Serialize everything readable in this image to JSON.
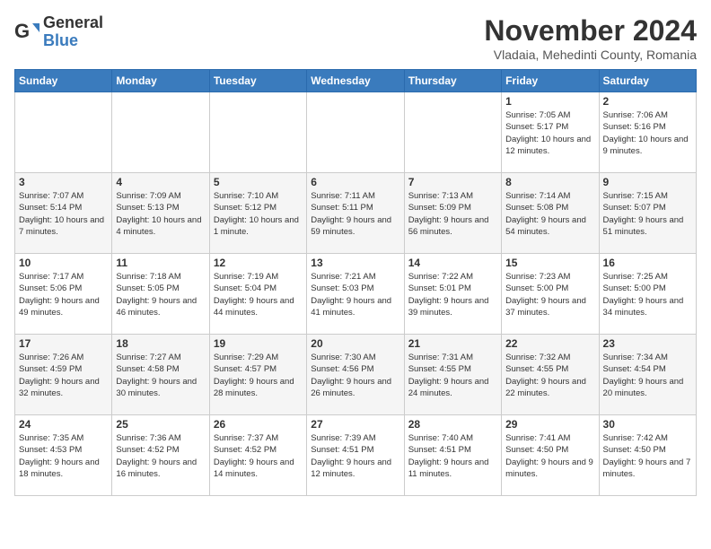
{
  "logo": {
    "general": "General",
    "blue": "Blue"
  },
  "header": {
    "month": "November 2024",
    "location": "Vladaia, Mehedinti County, Romania"
  },
  "weekdays": [
    "Sunday",
    "Monday",
    "Tuesday",
    "Wednesday",
    "Thursday",
    "Friday",
    "Saturday"
  ],
  "weeks": [
    [
      {
        "day": "",
        "info": ""
      },
      {
        "day": "",
        "info": ""
      },
      {
        "day": "",
        "info": ""
      },
      {
        "day": "",
        "info": ""
      },
      {
        "day": "",
        "info": ""
      },
      {
        "day": "1",
        "info": "Sunrise: 7:05 AM\nSunset: 5:17 PM\nDaylight: 10 hours and 12 minutes."
      },
      {
        "day": "2",
        "info": "Sunrise: 7:06 AM\nSunset: 5:16 PM\nDaylight: 10 hours and 9 minutes."
      }
    ],
    [
      {
        "day": "3",
        "info": "Sunrise: 7:07 AM\nSunset: 5:14 PM\nDaylight: 10 hours and 7 minutes."
      },
      {
        "day": "4",
        "info": "Sunrise: 7:09 AM\nSunset: 5:13 PM\nDaylight: 10 hours and 4 minutes."
      },
      {
        "day": "5",
        "info": "Sunrise: 7:10 AM\nSunset: 5:12 PM\nDaylight: 10 hours and 1 minute."
      },
      {
        "day": "6",
        "info": "Sunrise: 7:11 AM\nSunset: 5:11 PM\nDaylight: 9 hours and 59 minutes."
      },
      {
        "day": "7",
        "info": "Sunrise: 7:13 AM\nSunset: 5:09 PM\nDaylight: 9 hours and 56 minutes."
      },
      {
        "day": "8",
        "info": "Sunrise: 7:14 AM\nSunset: 5:08 PM\nDaylight: 9 hours and 54 minutes."
      },
      {
        "day": "9",
        "info": "Sunrise: 7:15 AM\nSunset: 5:07 PM\nDaylight: 9 hours and 51 minutes."
      }
    ],
    [
      {
        "day": "10",
        "info": "Sunrise: 7:17 AM\nSunset: 5:06 PM\nDaylight: 9 hours and 49 minutes."
      },
      {
        "day": "11",
        "info": "Sunrise: 7:18 AM\nSunset: 5:05 PM\nDaylight: 9 hours and 46 minutes."
      },
      {
        "day": "12",
        "info": "Sunrise: 7:19 AM\nSunset: 5:04 PM\nDaylight: 9 hours and 44 minutes."
      },
      {
        "day": "13",
        "info": "Sunrise: 7:21 AM\nSunset: 5:03 PM\nDaylight: 9 hours and 41 minutes."
      },
      {
        "day": "14",
        "info": "Sunrise: 7:22 AM\nSunset: 5:01 PM\nDaylight: 9 hours and 39 minutes."
      },
      {
        "day": "15",
        "info": "Sunrise: 7:23 AM\nSunset: 5:00 PM\nDaylight: 9 hours and 37 minutes."
      },
      {
        "day": "16",
        "info": "Sunrise: 7:25 AM\nSunset: 5:00 PM\nDaylight: 9 hours and 34 minutes."
      }
    ],
    [
      {
        "day": "17",
        "info": "Sunrise: 7:26 AM\nSunset: 4:59 PM\nDaylight: 9 hours and 32 minutes."
      },
      {
        "day": "18",
        "info": "Sunrise: 7:27 AM\nSunset: 4:58 PM\nDaylight: 9 hours and 30 minutes."
      },
      {
        "day": "19",
        "info": "Sunrise: 7:29 AM\nSunset: 4:57 PM\nDaylight: 9 hours and 28 minutes."
      },
      {
        "day": "20",
        "info": "Sunrise: 7:30 AM\nSunset: 4:56 PM\nDaylight: 9 hours and 26 minutes."
      },
      {
        "day": "21",
        "info": "Sunrise: 7:31 AM\nSunset: 4:55 PM\nDaylight: 9 hours and 24 minutes."
      },
      {
        "day": "22",
        "info": "Sunrise: 7:32 AM\nSunset: 4:55 PM\nDaylight: 9 hours and 22 minutes."
      },
      {
        "day": "23",
        "info": "Sunrise: 7:34 AM\nSunset: 4:54 PM\nDaylight: 9 hours and 20 minutes."
      }
    ],
    [
      {
        "day": "24",
        "info": "Sunrise: 7:35 AM\nSunset: 4:53 PM\nDaylight: 9 hours and 18 minutes."
      },
      {
        "day": "25",
        "info": "Sunrise: 7:36 AM\nSunset: 4:52 PM\nDaylight: 9 hours and 16 minutes."
      },
      {
        "day": "26",
        "info": "Sunrise: 7:37 AM\nSunset: 4:52 PM\nDaylight: 9 hours and 14 minutes."
      },
      {
        "day": "27",
        "info": "Sunrise: 7:39 AM\nSunset: 4:51 PM\nDaylight: 9 hours and 12 minutes."
      },
      {
        "day": "28",
        "info": "Sunrise: 7:40 AM\nSunset: 4:51 PM\nDaylight: 9 hours and 11 minutes."
      },
      {
        "day": "29",
        "info": "Sunrise: 7:41 AM\nSunset: 4:50 PM\nDaylight: 9 hours and 9 minutes."
      },
      {
        "day": "30",
        "info": "Sunrise: 7:42 AM\nSunset: 4:50 PM\nDaylight: 9 hours and 7 minutes."
      }
    ]
  ]
}
